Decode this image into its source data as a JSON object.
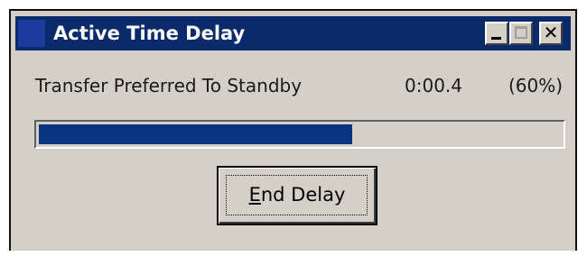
{
  "window": {
    "title": "Active Time Delay",
    "controls": {
      "minimize_icon": "minimize-icon",
      "maximize_icon": "maximize-icon",
      "close_icon": "close-icon",
      "close_glyph": "✕"
    }
  },
  "status": {
    "task": "Transfer Preferred To Standby",
    "elapsed": "0:00.4",
    "percent_text": "(60%)"
  },
  "progress": {
    "value": 0.6
  },
  "end_button": {
    "mnemonic": "E",
    "rest": "nd Delay"
  },
  "colors": {
    "titlebar": "#0a2a6b",
    "progress_fill": "#0a3482",
    "dialog_face": "#d4d0c8"
  }
}
